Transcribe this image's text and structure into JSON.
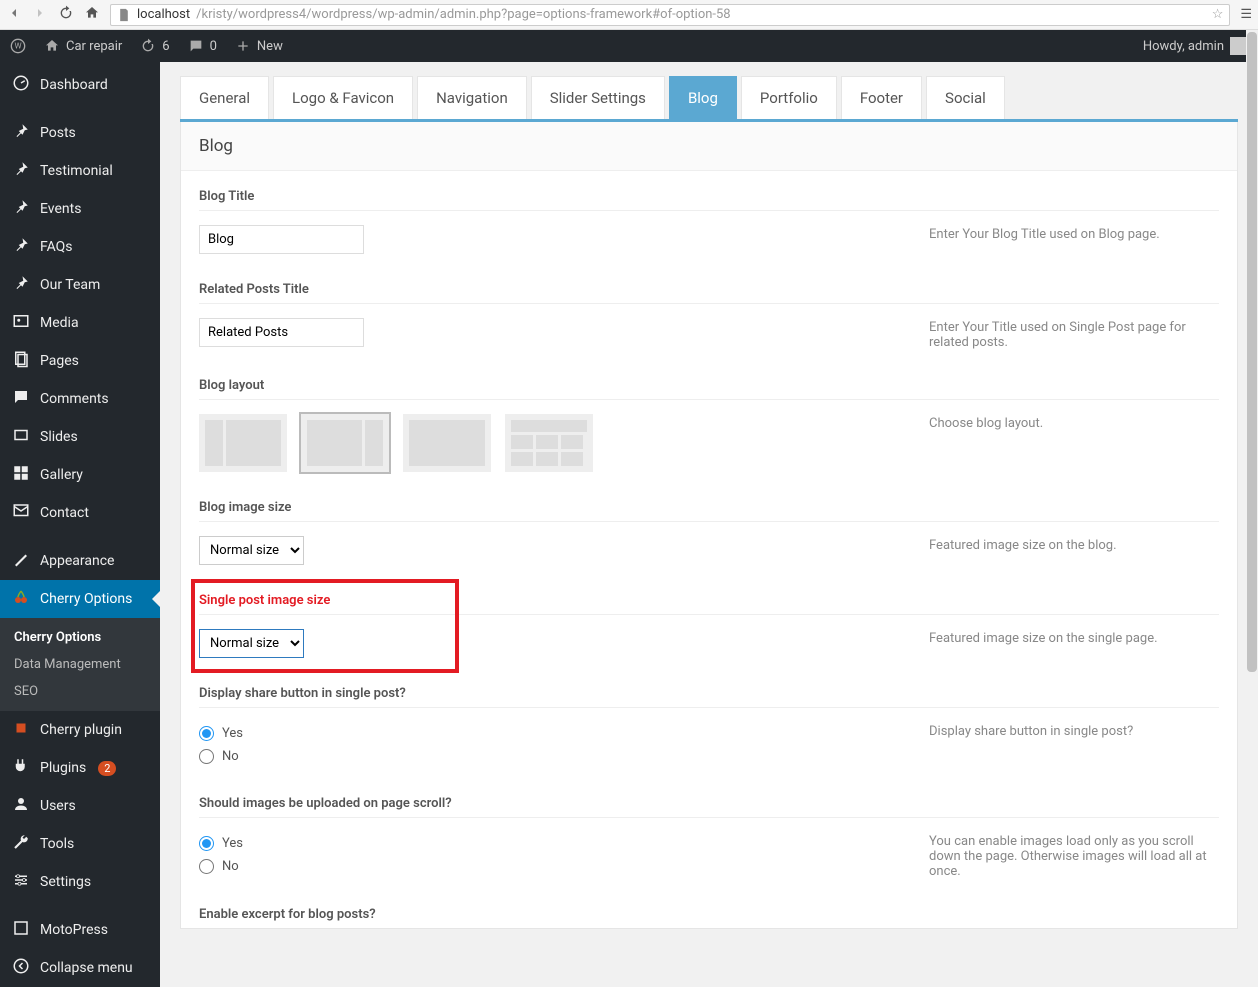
{
  "browser": {
    "url_host": "localhost",
    "url_path": "/kristy/wordpress4/wordpress/wp-admin/admin.php?page=options-framework#of-option-58"
  },
  "adminbar": {
    "site_name": "Car repair",
    "updates_count": "6",
    "comments_count": "0",
    "new_label": "New",
    "howdy": "Howdy, admin"
  },
  "sidebar": {
    "items": [
      {
        "label": "Dashboard",
        "icon": "dashboard-icon"
      },
      {
        "sep": true
      },
      {
        "label": "Posts",
        "icon": "pin-icon"
      },
      {
        "label": "Testimonial",
        "icon": "pin-icon"
      },
      {
        "label": "Events",
        "icon": "pin-icon"
      },
      {
        "label": "FAQs",
        "icon": "pin-icon"
      },
      {
        "label": "Our Team",
        "icon": "pin-icon"
      },
      {
        "label": "Media",
        "icon": "media-icon"
      },
      {
        "label": "Pages",
        "icon": "pages-icon"
      },
      {
        "label": "Comments",
        "icon": "comments-icon"
      },
      {
        "label": "Slides",
        "icon": "slides-icon"
      },
      {
        "label": "Gallery",
        "icon": "gallery-icon"
      },
      {
        "label": "Contact",
        "icon": "contact-icon"
      },
      {
        "sep": true
      },
      {
        "label": "Appearance",
        "icon": "appearance-icon"
      },
      {
        "label": "Cherry Options",
        "icon": "cherry-icon",
        "current": true
      },
      {
        "submenu": [
          {
            "label": "Cherry Options",
            "active": true
          },
          {
            "label": "Data Management"
          },
          {
            "label": "SEO"
          }
        ]
      },
      {
        "label": "Cherry plugin",
        "icon": "cherry-plugin-icon",
        "red": true
      },
      {
        "label": "Plugins",
        "icon": "plugins-icon",
        "badge": "2"
      },
      {
        "label": "Users",
        "icon": "users-icon"
      },
      {
        "label": "Tools",
        "icon": "tools-icon"
      },
      {
        "label": "Settings",
        "icon": "settings-icon"
      },
      {
        "sep": true
      },
      {
        "label": "MotoPress",
        "icon": "motopress-icon"
      },
      {
        "label": "Collapse menu",
        "icon": "collapse-icon"
      }
    ]
  },
  "tabs": [
    {
      "label": "General"
    },
    {
      "label": "Logo & Favicon"
    },
    {
      "label": "Navigation"
    },
    {
      "label": "Slider Settings"
    },
    {
      "label": "Blog",
      "active": true
    },
    {
      "label": "Portfolio"
    },
    {
      "label": "Footer"
    },
    {
      "label": "Social"
    }
  ],
  "panel": {
    "title": "Blog",
    "sections": {
      "blog_title": {
        "heading": "Blog Title",
        "value": "Blog",
        "help": "Enter Your Blog Title used on Blog page."
      },
      "related_posts_title": {
        "heading": "Related Posts Title",
        "value": "Related Posts",
        "help": "Enter Your Title used on Single Post page for related posts."
      },
      "blog_layout": {
        "heading": "Blog layout",
        "help": "Choose blog layout."
      },
      "blog_image_size": {
        "heading": "Blog image size",
        "value": "Normal size",
        "help": "Featured image size on the blog."
      },
      "single_post_image_size": {
        "heading": "Single post image size",
        "value": "Normal size",
        "help": "Featured image size on the single page."
      },
      "display_share": {
        "heading": "Display share button in single post?",
        "yes": "Yes",
        "no": "No",
        "help": "Display share button in single post?"
      },
      "lazy_images": {
        "heading": "Should images be uploaded on page scroll?",
        "yes": "Yes",
        "no": "No",
        "help": "You can enable images load only as you scroll down the page. Otherwise images will load all at once."
      },
      "enable_excerpt": {
        "heading": "Enable excerpt for blog posts?"
      }
    }
  }
}
